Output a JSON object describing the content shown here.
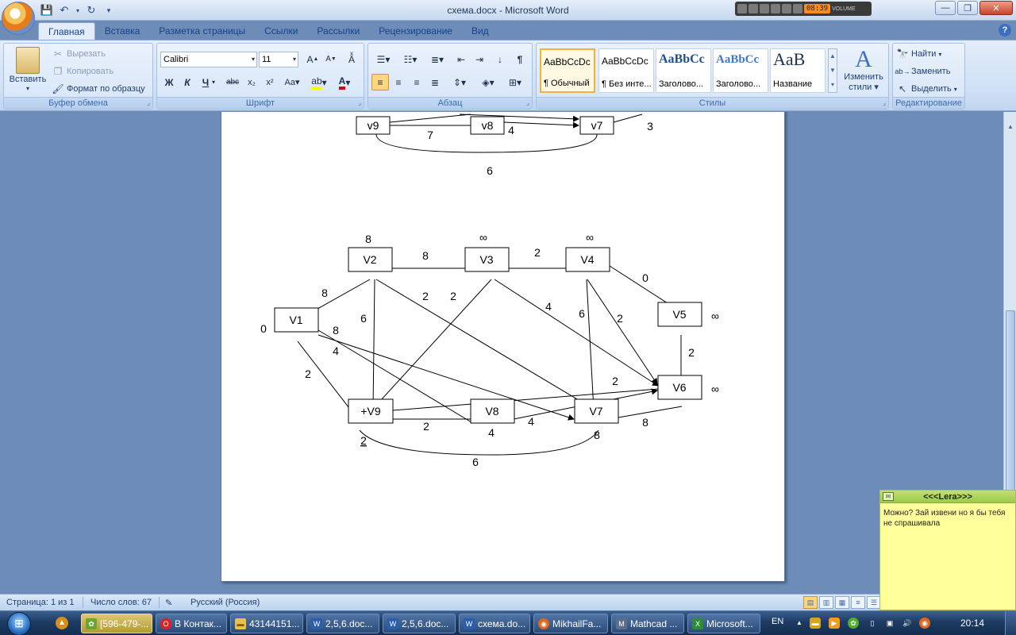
{
  "window": {
    "title": "схема.docx - Microsoft Word"
  },
  "media_player": {
    "time": "08:39",
    "volume_label": "VOLUME"
  },
  "tabs": [
    "Главная",
    "Вставка",
    "Разметка страницы",
    "Ссылки",
    "Рассылки",
    "Рецензирование",
    "Вид"
  ],
  "ribbon": {
    "clipboard": {
      "label": "Буфер обмена",
      "paste": "Вставить",
      "cut": "Вырезать",
      "copy": "Копировать",
      "format_painter": "Формат по образцу"
    },
    "font": {
      "label": "Шрифт",
      "family": "Calibri",
      "size": "11"
    },
    "paragraph": {
      "label": "Абзац"
    },
    "styles": {
      "label": "Стилы",
      "items": [
        {
          "sample": "AaBbCcDc",
          "name": "¶ Обычный",
          "selected": true
        },
        {
          "sample": "AaBbCcDc",
          "name": "¶ Без инте...",
          "selected": false
        },
        {
          "sample": "AaBbCc",
          "name": "Заголово...",
          "selected": false
        },
        {
          "sample": "AaBbCc",
          "name": "Заголово...",
          "selected": false
        },
        {
          "sample": "AaB",
          "name": "Название",
          "selected": false
        }
      ],
      "change_styles_1": "Изменить",
      "change_styles_2": "стили"
    },
    "editing": {
      "label": "Редактирование",
      "find": "Найти",
      "replace": "Заменить",
      "select": "Выделить"
    }
  },
  "graph_top": {
    "nodes": [
      {
        "id": "top-v9",
        "label": "v9"
      },
      {
        "id": "top-v8",
        "label": "v8"
      },
      {
        "id": "top-v7",
        "label": "v7"
      }
    ],
    "labels": [
      "7",
      "4",
      "3",
      "6"
    ]
  },
  "graph_main": {
    "nodes": [
      {
        "id": "v1",
        "label": "V1"
      },
      {
        "id": "v2",
        "label": "V2"
      },
      {
        "id": "v3",
        "label": "V3"
      },
      {
        "id": "v4",
        "label": "V4"
      },
      {
        "id": "v5",
        "label": "V5"
      },
      {
        "id": "v6",
        "label": "V6"
      },
      {
        "id": "v7",
        "label": "V7"
      },
      {
        "id": "v8",
        "label": "V8"
      },
      {
        "id": "v9",
        "label": "+V9"
      }
    ],
    "node_marks": {
      "v1": "0",
      "v2": "8",
      "v3": "∞",
      "v4": "∞",
      "v5": "∞",
      "v6": "∞",
      "v7": "8",
      "v8": "4",
      "v9": "2"
    },
    "edge_labels": [
      "8",
      "2",
      "0",
      "8",
      "2",
      "2",
      "4",
      "6",
      "6",
      "2",
      "8",
      "4",
      "2",
      "2",
      "2",
      "2",
      "4",
      "8",
      "6"
    ]
  },
  "statusbar": {
    "page": "Страница: 1 из 1",
    "words": "Число слов: 67",
    "language": "Русский (Россия)"
  },
  "chat": {
    "title": "<<<Lera>>>",
    "message": "Можно? Зай извени но я бы тебя не спрашивала"
  },
  "taskbar": {
    "items": [
      {
        "label": "[596-479-...",
        "active": true
      },
      {
        "label": "В Контак...",
        "active": false
      },
      {
        "label": "43144151...",
        "active": false
      },
      {
        "label": "2,5,6.doc...",
        "active": false
      },
      {
        "label": "2,5,6.doc...",
        "active": false
      },
      {
        "label": "схема.do...",
        "active": false
      },
      {
        "label": "MikhailFa...",
        "active": false
      },
      {
        "label": "Mathcad ...",
        "active": false
      },
      {
        "label": "Microsoft...",
        "active": false
      }
    ],
    "lang": "EN",
    "clock": "20:14"
  }
}
